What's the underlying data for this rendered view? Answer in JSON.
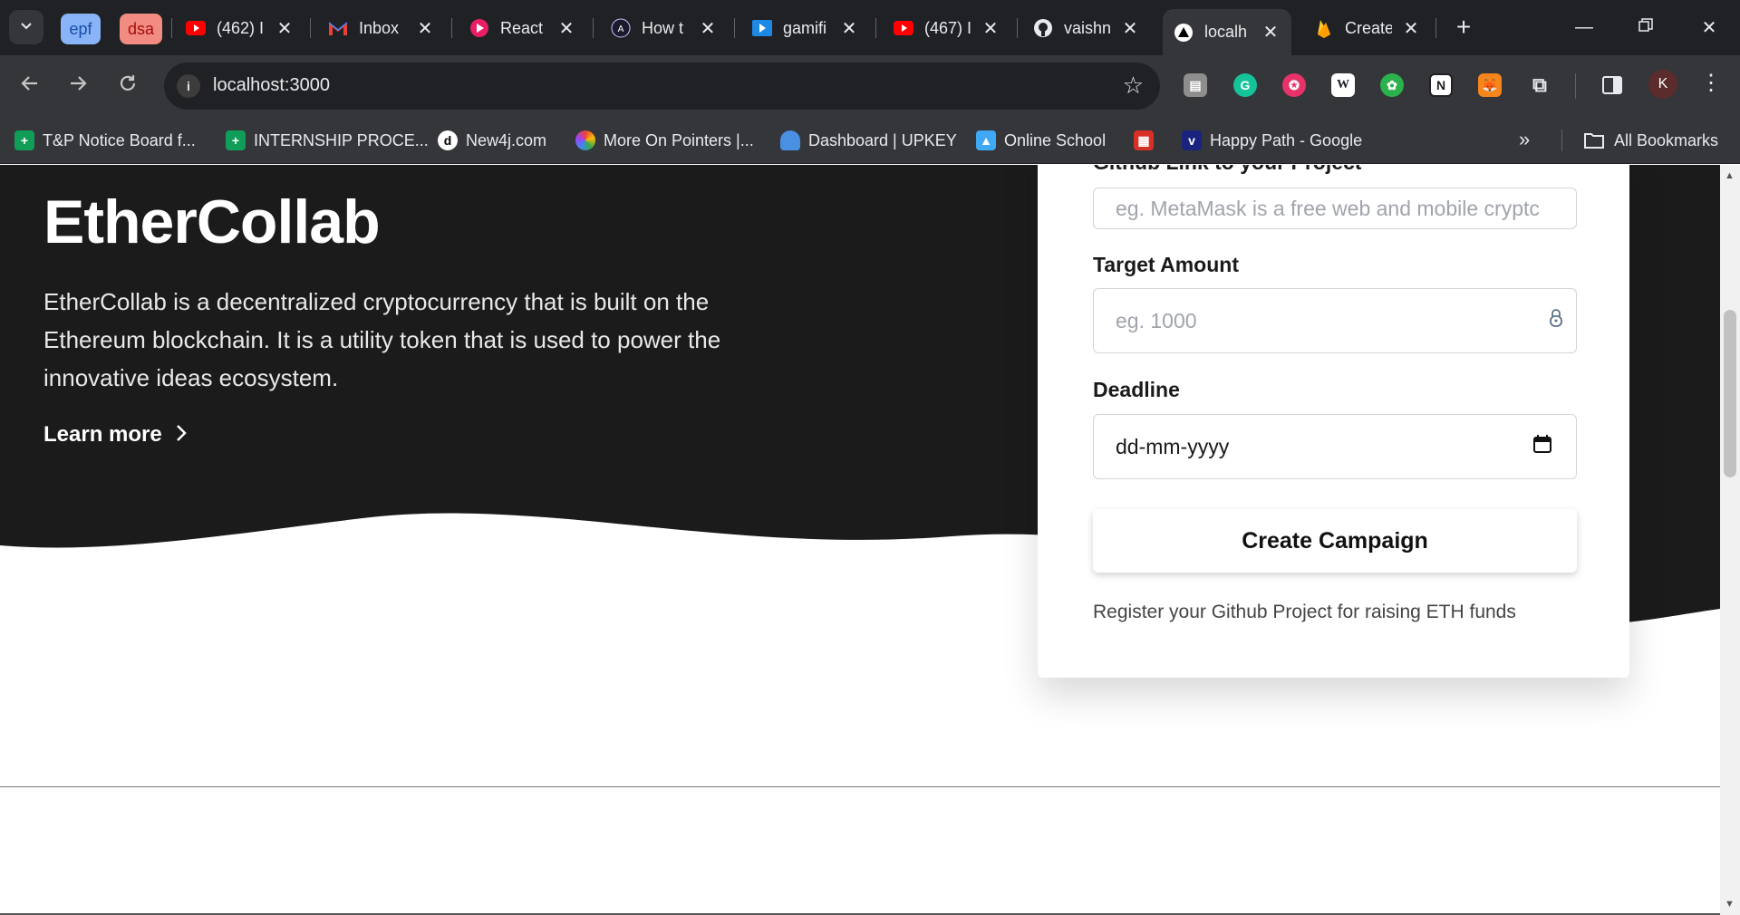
{
  "browser": {
    "tab_groups": [
      {
        "label": "epf",
        "bg": "#8ab4f8",
        "fg": "#174ea6"
      },
      {
        "label": "dsa",
        "bg": "#f28b82",
        "fg": "#a50e0e"
      }
    ],
    "tabs": [
      {
        "title": "(462) I",
        "icon": "youtube-icon"
      },
      {
        "title": "Inbox",
        "icon": "gmail-icon"
      },
      {
        "title": "React",
        "icon": "react-course-icon"
      },
      {
        "title": "How t",
        "icon": "astro-icon"
      },
      {
        "title": "gamifi",
        "icon": "video-icon"
      },
      {
        "title": "(467) I",
        "icon": "youtube-icon"
      },
      {
        "title": "vaishn",
        "icon": "github-icon"
      },
      {
        "title": "localh",
        "icon": "nextjs-icon",
        "active": true
      },
      {
        "title": "Create",
        "icon": "firebase-icon"
      }
    ],
    "address_bar": {
      "url": "localhost:3000"
    },
    "profile_initial": "K",
    "bookmarks": [
      {
        "label": "T&P Notice Board f...",
        "icon": "sheets-icon"
      },
      {
        "label": "INTERNSHIP PROCE...",
        "icon": "sheets-icon"
      },
      {
        "label": "New4j.com",
        "icon": "new4j-icon"
      },
      {
        "label": "More On Pointers |...",
        "icon": "pointers-icon"
      },
      {
        "label": "Dashboard | UPKEY",
        "icon": "upkey-icon"
      },
      {
        "label": "Online School",
        "icon": "online-school-icon"
      },
      {
        "label": "",
        "icon": "store-icon"
      },
      {
        "label": "Happy Path - Google",
        "icon": "happy-path-icon"
      }
    ],
    "all_bookmarks_label": "All Bookmarks"
  },
  "hero": {
    "brand": "EtherCollab",
    "description": "EtherCollab is a decentralized cryptocurrency that is built on the Ethereum blockchain. It is a utility token that is used to power the innovative ideas ecosystem.",
    "learn_more": "Learn more"
  },
  "form": {
    "github_label": "Github Link to your Project",
    "github_placeholder": "eg. MetaMask is a free web and mobile cryptc",
    "target_label": "Target Amount",
    "target_placeholder": "eg. 1000",
    "deadline_label": "Deadline",
    "deadline_value": "dd-mm-yyyy",
    "submit_label": "Create Campaign",
    "note": "Register your Github Project for raising ETH funds"
  },
  "colors": {
    "hero_bg": "#1b1b1c",
    "chrome_dark": "#202124",
    "chrome_toolbar": "#35363a"
  }
}
